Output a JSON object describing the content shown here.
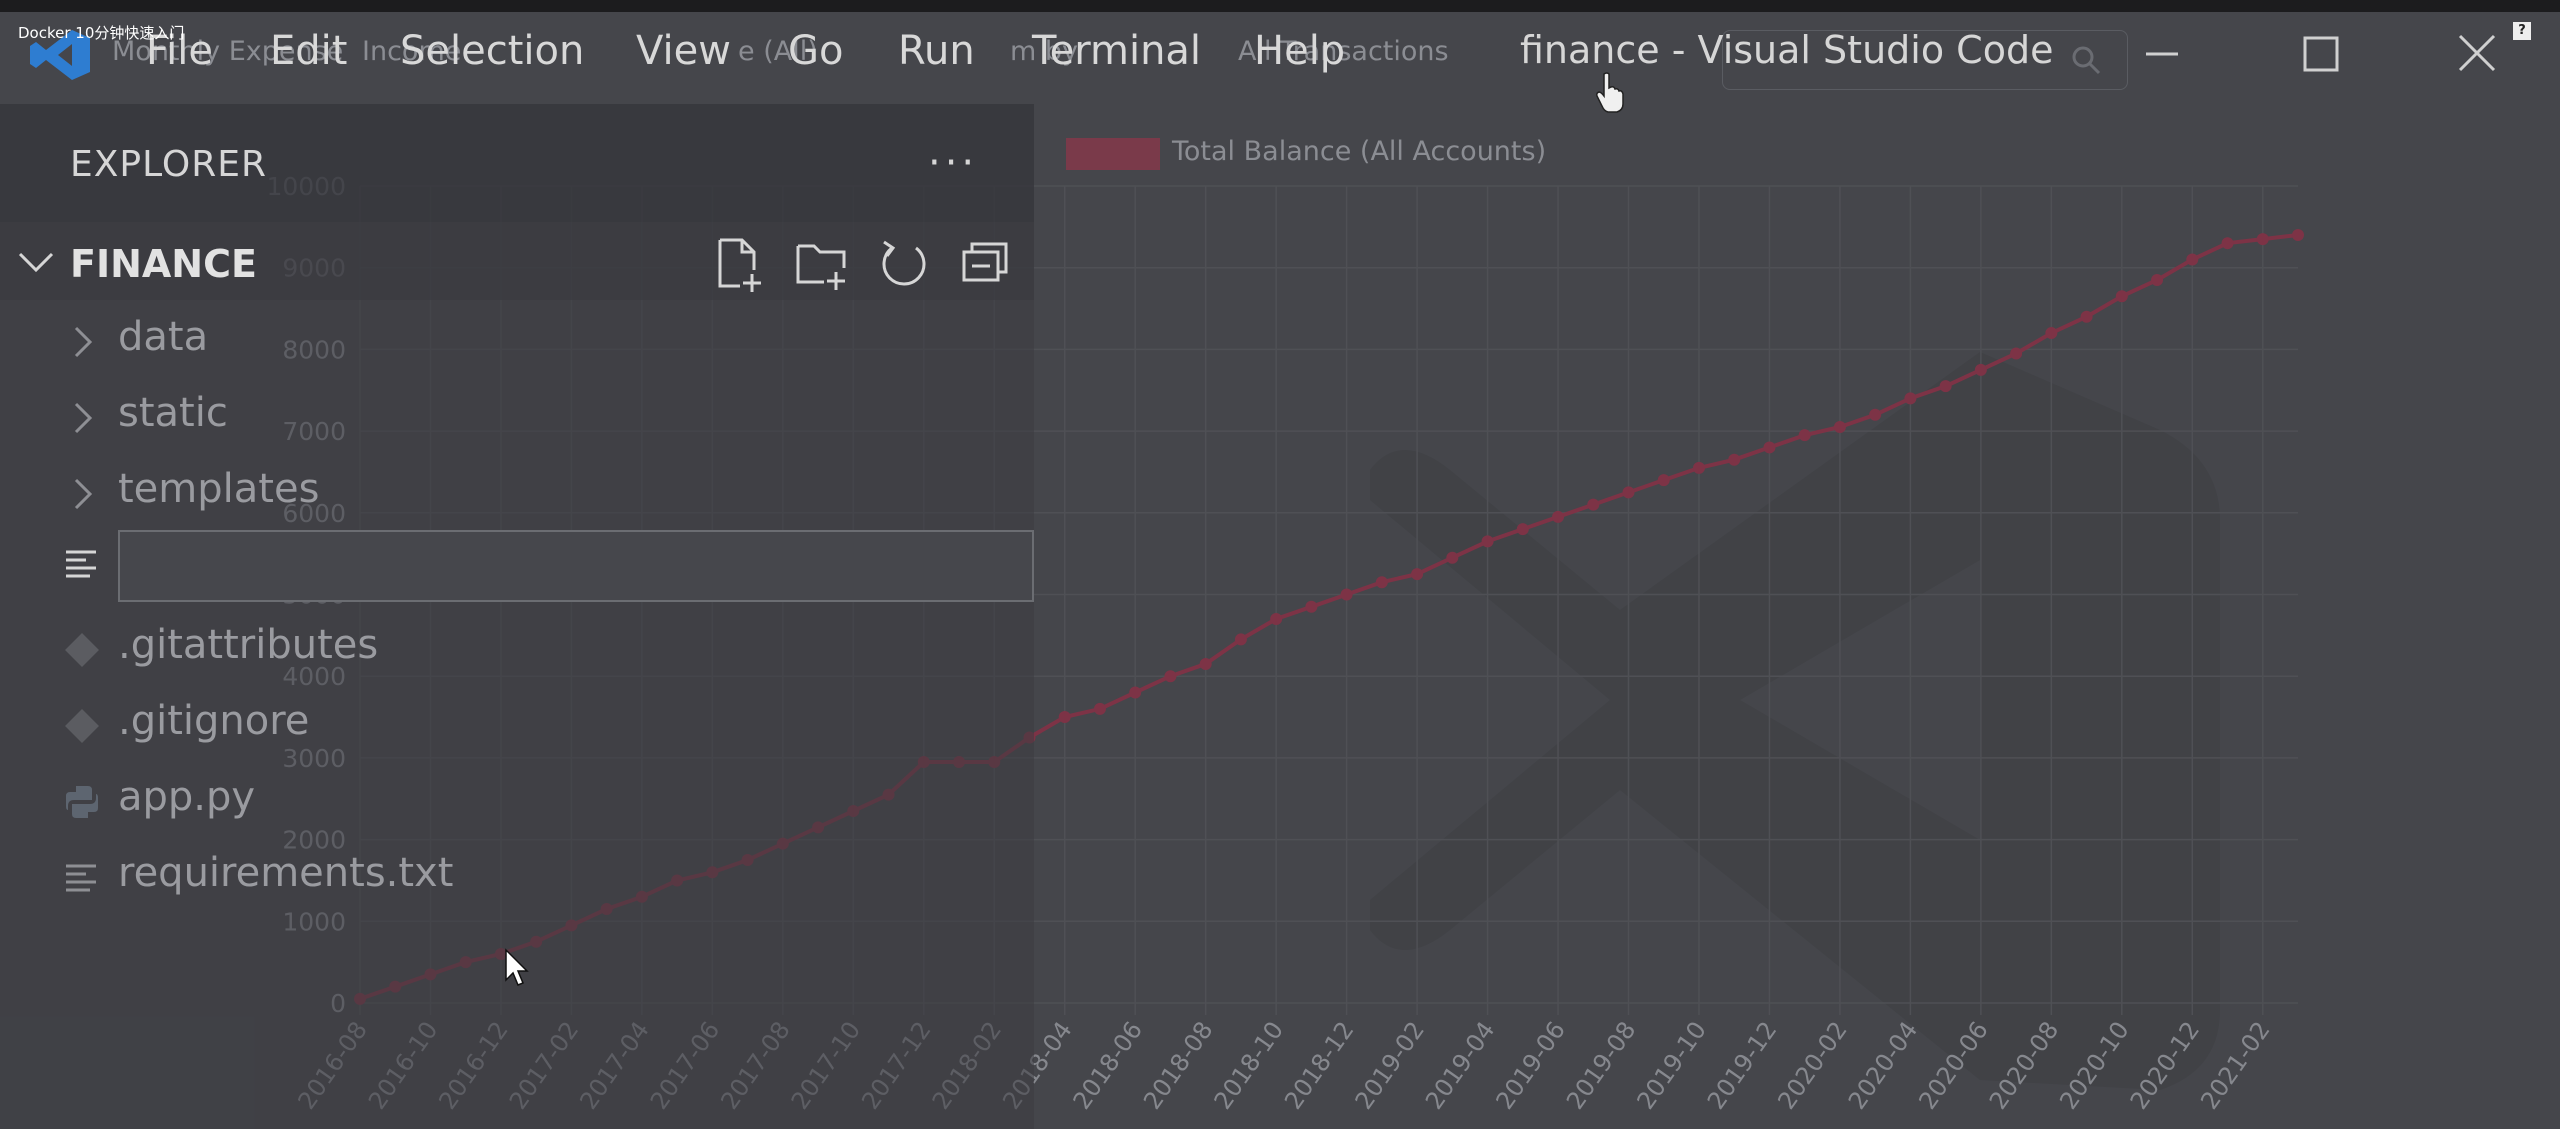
{
  "video_title": "Docker 10分钟快速入门",
  "corner_badge": "?",
  "menu": {
    "file": "File",
    "edit": "Edit",
    "selection": "Selection",
    "view": "View",
    "go": "Go",
    "run": "Run",
    "terminal": "Terminal",
    "help": "Help"
  },
  "window_title": "finance - Visual Studio Code",
  "explorer": {
    "title": "EXPLORER",
    "more": "···",
    "folder": "FINANCE",
    "items": [
      {
        "label": "data",
        "kind": "folder"
      },
      {
        "label": "static",
        "kind": "folder"
      },
      {
        "label": "templates",
        "kind": "folder"
      },
      {
        "label": ".gitattributes",
        "kind": "git"
      },
      {
        "label": ".gitignore",
        "kind": "git"
      },
      {
        "label": "app.py",
        "kind": "python"
      },
      {
        "label": "requirements.txt",
        "kind": "text"
      }
    ],
    "rename_value": ""
  },
  "chart_tabs": [
    "Monthly Expense",
    "Income",
    "e (All)",
    "m by",
    "All Transactions"
  ],
  "colors": {
    "line": "#7d3346",
    "accent": "#3c8fd6"
  },
  "icons": [
    "vscode-logo-icon",
    "minimize-icon",
    "maximize-icon",
    "close-icon",
    "chevron-down-icon",
    "chevron-right-icon",
    "new-file-icon",
    "new-folder-icon",
    "refresh-icon",
    "collapse-all-icon",
    "lines-file-icon",
    "git-icon",
    "python-icon",
    "search-icon",
    "hand-cursor-icon",
    "arrow-cursor-icon"
  ],
  "chart_data": {
    "type": "line",
    "title": "",
    "legend": [
      "Total Balance (All Accounts)"
    ],
    "legend_position": "top-left",
    "grid": true,
    "ylim": [
      0,
      10000
    ],
    "yticks": [
      0,
      1000,
      2000,
      3000,
      4000,
      5000,
      6000,
      7000,
      8000,
      9000,
      10000
    ],
    "xtick_labels": [
      "2016-08",
      "2016-10",
      "2016-12",
      "2017-02",
      "2017-04",
      "2017-06",
      "2017-08",
      "2017-10",
      "2017-12",
      "2018-02",
      "2018-04",
      "2018-06",
      "2018-08",
      "2018-10",
      "2018-12",
      "2019-02",
      "2019-04",
      "2019-06",
      "2019-08",
      "2019-10",
      "2019-12",
      "2020-02",
      "2020-04",
      "2020-06",
      "2020-08",
      "2020-10",
      "2020-12",
      "2021-02"
    ],
    "series": [
      {
        "name": "Total Balance (All Accounts)",
        "x": [
          "2016-08",
          "2016-09",
          "2016-10",
          "2016-11",
          "2016-12",
          "2017-01",
          "2017-02",
          "2017-03",
          "2017-04",
          "2017-05",
          "2017-06",
          "2017-07",
          "2017-08",
          "2017-09",
          "2017-10",
          "2017-11",
          "2017-12",
          "2018-01",
          "2018-02",
          "2018-03",
          "2018-04",
          "2018-05",
          "2018-06",
          "2018-07",
          "2018-08",
          "2018-09",
          "2018-10",
          "2018-11",
          "2018-12",
          "2019-01",
          "2019-02",
          "2019-03",
          "2019-04",
          "2019-05",
          "2019-06",
          "2019-07",
          "2019-08",
          "2019-09",
          "2019-10",
          "2019-11",
          "2019-12",
          "2020-01",
          "2020-02",
          "2020-03",
          "2020-04",
          "2020-05",
          "2020-06",
          "2020-07",
          "2020-08",
          "2020-09",
          "2020-10",
          "2020-11",
          "2020-12",
          "2021-01",
          "2021-02",
          "2021-03"
        ],
        "values": [
          50,
          200,
          350,
          500,
          600,
          750,
          950,
          1150,
          1300,
          1500,
          1600,
          1750,
          1950,
          2150,
          2350,
          2550,
          2950,
          2950,
          2950,
          3250,
          3500,
          3600,
          3800,
          4000,
          4150,
          4450,
          4700,
          4850,
          5000,
          5150,
          5250,
          5450,
          5650,
          5800,
          5950,
          6100,
          6250,
          6400,
          6550,
          6650,
          6800,
          6950,
          7050,
          7200,
          7400,
          7550,
          7750,
          7950,
          8200,
          8400,
          8650,
          8850,
          9100,
          9300,
          9350,
          9400
        ]
      }
    ]
  }
}
